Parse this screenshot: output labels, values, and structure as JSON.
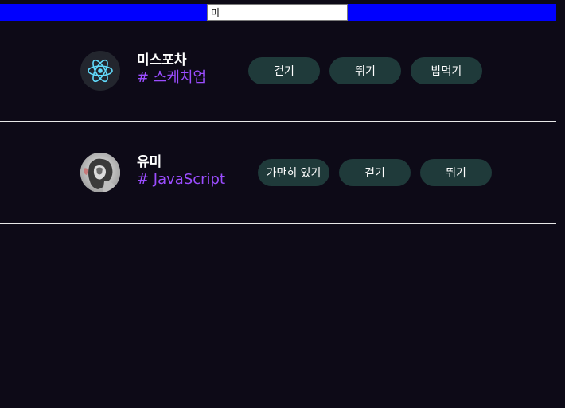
{
  "search": {
    "value": "미"
  },
  "cards": [
    {
      "name": "미스포차",
      "tag": "# 스케치업",
      "avatar_icon": "react-logo-icon",
      "actions": [
        "걷기",
        "뛰기",
        "밥먹기"
      ]
    },
    {
      "name": "유미",
      "tag": "# JavaScript",
      "avatar_icon": "profile-photo",
      "actions": [
        "가만히 있기",
        "걷기",
        "뛰기"
      ]
    }
  ],
  "colors": {
    "top_bar": "#0000ff",
    "background": "#0d0a17",
    "tag": "#9b4dff",
    "button": "#1f3a3a",
    "divider": "#e8e8e8"
  }
}
